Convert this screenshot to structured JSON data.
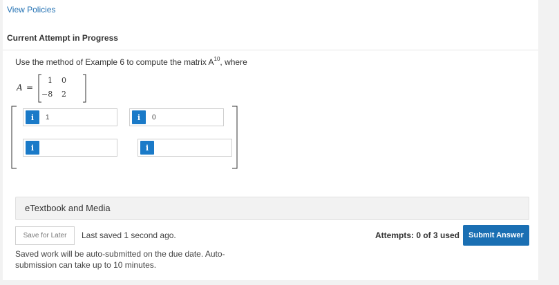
{
  "header": {
    "view_policies": "View Policies"
  },
  "attempt": {
    "title": "Current Attempt in Progress"
  },
  "question": {
    "text_before": "Use the method of Example 6 to compute the matrix ",
    "matrix_var": "A",
    "exponent": "10",
    "text_after": ", where",
    "lhs": "A",
    "equals": "=",
    "matrix": [
      [
        "1",
        "0"
      ],
      [
        "−8",
        "2"
      ]
    ]
  },
  "answers": {
    "info_glyph": "i",
    "cells": [
      {
        "value": "1"
      },
      {
        "value": "0"
      },
      {
        "value": ""
      },
      {
        "value": ""
      }
    ]
  },
  "etextbook": {
    "label": "eTextbook and Media"
  },
  "footer": {
    "save_label": "Save for Later",
    "last_saved": "Last saved 1 second ago.",
    "auto_submit": "Saved work will be auto-submitted on the due date. Auto-submission can take up to 10 minutes.",
    "attempts": "Attempts: 0 of 3 used",
    "submit_label": "Submit Answer"
  },
  "colors": {
    "accent": "#1a6fb3",
    "link": "#1f6fb2",
    "info_badge": "#1a7ac8"
  }
}
